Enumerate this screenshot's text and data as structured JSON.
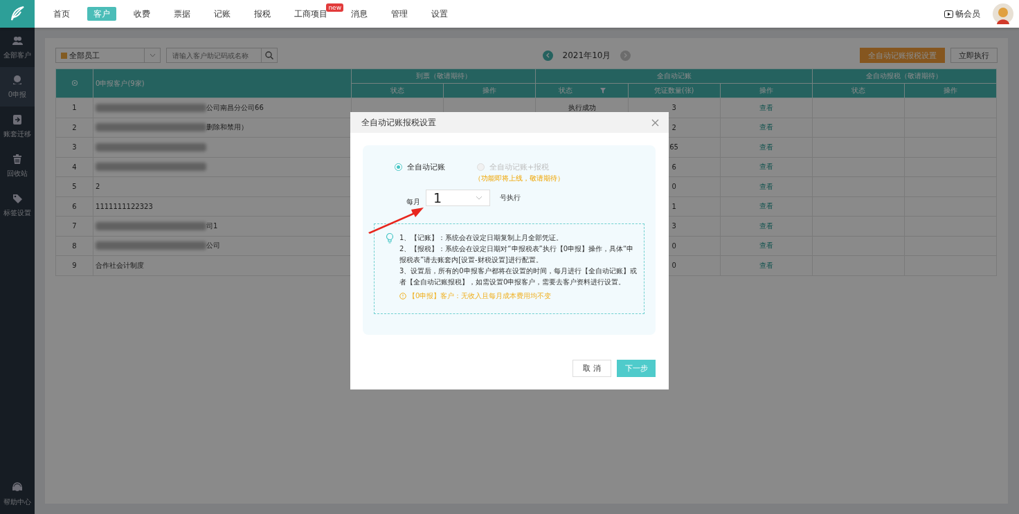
{
  "topnav": {
    "items": [
      {
        "label": "首页",
        "selected": false
      },
      {
        "label": "客户",
        "selected": true
      },
      {
        "label": "收费",
        "selected": false
      },
      {
        "label": "票据",
        "selected": false
      },
      {
        "label": "记账",
        "selected": false
      },
      {
        "label": "报税",
        "selected": false
      },
      {
        "label": "工商项目",
        "selected": false,
        "badge": "new"
      },
      {
        "label": "消息",
        "selected": false
      },
      {
        "label": "管理",
        "selected": false
      },
      {
        "label": "设置",
        "selected": false
      }
    ],
    "member_link": "畅会员"
  },
  "sidebar": {
    "items": [
      {
        "label": "全部客户",
        "selected": false
      },
      {
        "label": "0申报",
        "selected": true
      },
      {
        "label": "账套迁移",
        "selected": false
      },
      {
        "label": "回收站",
        "selected": false
      },
      {
        "label": "标签设置",
        "selected": false
      }
    ],
    "help": "帮助中心"
  },
  "toolbar": {
    "staff_filter": "全部员工",
    "search": {
      "placeholder": "请输入客户助记码或名称"
    },
    "month": {
      "label": "2021年10月",
      "prev_disabled": false,
      "next_disabled": true
    },
    "buttons": [
      {
        "label": "全自动记账报税设置",
        "kind": "primary"
      },
      {
        "label": "立即执行",
        "kind": "default"
      }
    ]
  },
  "table": {
    "name_header": "0申报客户(9家)",
    "groups": [
      {
        "title": "到票（敬请期待）",
        "columns": [
          {
            "label": "状态",
            "filterable": false
          },
          {
            "label": "操作",
            "filterable": false
          }
        ]
      },
      {
        "title": "全自动记账",
        "columns": [
          {
            "label": "状态",
            "filterable": true
          },
          {
            "label": "凭证数量(张)",
            "filterable": false
          },
          {
            "label": "操作",
            "filterable": false
          }
        ]
      },
      {
        "title": "全自动报税（敬请期待）",
        "columns": [
          {
            "label": "状态",
            "filterable": false
          },
          {
            "label": "操作",
            "filterable": false
          }
        ]
      }
    ],
    "rows": [
      {
        "index": "1",
        "redacted": true,
        "name": "公司南昌分公司66",
        "cells": [
          "",
          "",
          "执行成功",
          "3",
          "查看",
          "",
          ""
        ]
      },
      {
        "index": "2",
        "redacted": true,
        "name": "删除和禁用）",
        "cells": [
          "",
          "",
          "",
          "2",
          "查看",
          "",
          ""
        ]
      },
      {
        "index": "3",
        "redacted": true,
        "cells": [
          "",
          "",
          "",
          "65",
          "查看",
          "",
          ""
        ]
      },
      {
        "index": "4",
        "redacted": true,
        "cells": [
          "",
          "",
          "",
          "6",
          "查看",
          "",
          ""
        ]
      },
      {
        "index": "5",
        "redacted": false,
        "name": "2",
        "cells": [
          "",
          "",
          "",
          "0",
          "查看",
          "",
          ""
        ]
      },
      {
        "index": "6",
        "redacted": false,
        "name": "1111111122323",
        "cells": [
          "",
          "",
          "",
          "1",
          "查看",
          "",
          ""
        ]
      },
      {
        "index": "7",
        "redacted": true,
        "name": "司1",
        "cells": [
          "",
          "",
          "",
          "3",
          "查看",
          "",
          ""
        ]
      },
      {
        "index": "8",
        "redacted": true,
        "name": "公司",
        "cells": [
          "",
          "",
          "",
          "0",
          "查看",
          "",
          ""
        ]
      },
      {
        "index": "9",
        "redacted": false,
        "name": "合作社会计制度",
        "cells": [
          "",
          "",
          "",
          "0",
          "查看",
          "",
          ""
        ]
      }
    ]
  },
  "modal": {
    "title": "全自动记账报税设置",
    "options": [
      {
        "label": "全自动记账",
        "selected": true,
        "disabled": false
      },
      {
        "label": "全自动记账+报税",
        "selected": false,
        "disabled": true,
        "note": "（功能即将上线，敬请期待）"
      }
    ],
    "day_prefix": "每月",
    "day_value": "1",
    "day_suffix": "号执行",
    "notes": [
      "1、【记账】：系统会在设定日期复制上月全部凭证。",
      "2、【报税】：系统会在设定日期对“申报税表”执行【0申报】操作，具体“申报税表”请去账套内[设置-财税设置]进行配置。",
      "3、设置后，所有的0申报客户都将在设置的时间，每月进行【全自动记账】或者【全自动记账报税】，如需设置0申报客户，需要去客户资料进行设置。"
    ],
    "warning": "【0申报】客户：无收入且每月成本费用均不变",
    "buttons": [
      {
        "label": "取 消",
        "kind": "default"
      },
      {
        "label": "下一步",
        "kind": "primary"
      }
    ]
  }
}
